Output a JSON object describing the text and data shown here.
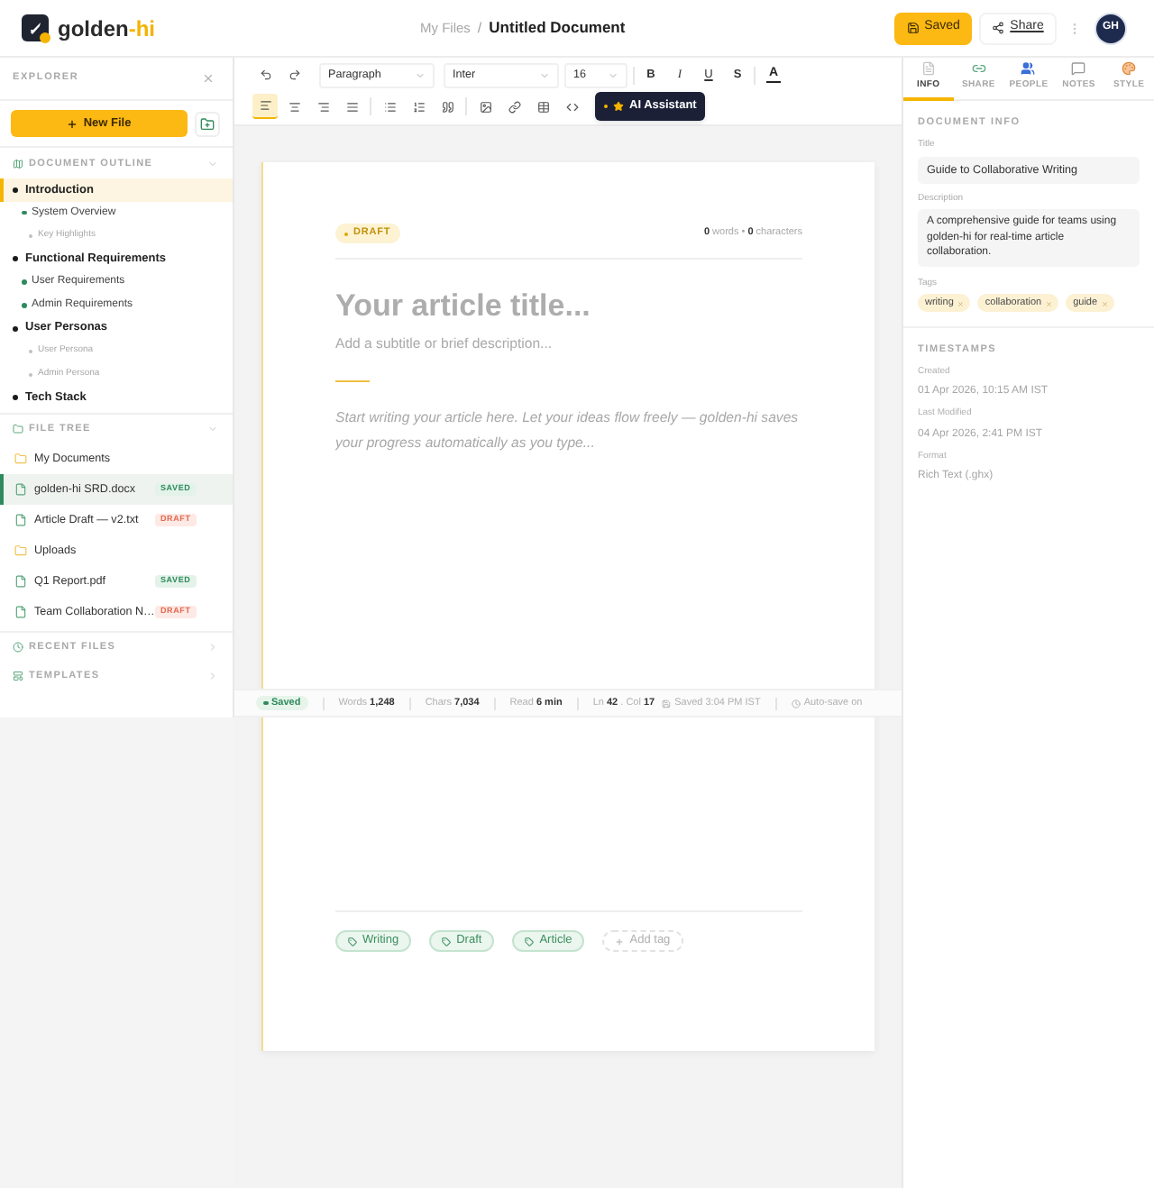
{
  "header": {
    "logo": {
      "name": "golden",
      "accent": "-hi"
    },
    "breadcrumb": {
      "parent": "My Files",
      "separator": "/",
      "current": "Untitled Document"
    },
    "actions": [
      {
        "kind": "save",
        "label": "Saved"
      },
      {
        "kind": "share",
        "label": "Share"
      }
    ],
    "avatar": "GH"
  },
  "sidebar": {
    "title": "EXPLORER",
    "new_file_button": "New File",
    "outline": {
      "title": "DOCUMENT OUTLINE",
      "expanded": true,
      "items": [
        {
          "kind": "h1",
          "label": "Introduction",
          "selected": true,
          "children": [
            {
              "kind": "h2",
              "label": "System Overview",
              "selected": false,
              "children": [
                {
                  "kind": "h3",
                  "label": "Key Highlights",
                  "selected": false
                }
              ]
            }
          ]
        },
        {
          "kind": "h1",
          "label": "Functional Requirements",
          "selected": false,
          "children": [
            {
              "kind": "h2",
              "label": "User Requirements",
              "selected": false
            },
            {
              "kind": "h2",
              "label": "Admin Requirements",
              "selected": false
            }
          ]
        },
        {
          "kind": "h1",
          "label": "User Personas",
          "selected": false,
          "children": [
            {
              "kind": "h3",
              "label": "User Persona",
              "selected": false
            },
            {
              "kind": "h3",
              "label": "Admin Persona",
              "selected": false
            }
          ]
        },
        {
          "kind": "h1",
          "label": "Tech Stack",
          "selected": false
        }
      ]
    },
    "file_tree": {
      "title": "FILE TREE",
      "expanded": true,
      "items": [
        {
          "kind": "folder",
          "name": "My Documents",
          "selected": false
        },
        {
          "kind": "file",
          "name": "golden-hi SRD.docx",
          "badge": {
            "kind": "saved",
            "label": "SAVED"
          },
          "selected": true
        },
        {
          "kind": "file",
          "name": "Article Draft — v2.txt",
          "badge": {
            "kind": "draft",
            "label": "DRAFT"
          },
          "selected": false
        },
        {
          "kind": "folder",
          "name": "Uploads",
          "selected": false
        },
        {
          "kind": "file",
          "name": "Q1 Report.pdf",
          "badge": {
            "kind": "saved",
            "label": "SAVED"
          },
          "selected": false
        },
        {
          "kind": "file",
          "name": "Team Collaboration N…",
          "badge": {
            "kind": "draft",
            "label": "DRAFT"
          },
          "selected": false
        }
      ]
    },
    "collapsed_sections": [
      {
        "kind": "recent",
        "title": "RECENT FILES",
        "expanded": false
      },
      {
        "kind": "templates",
        "title": "TEMPLATES",
        "expanded": false
      }
    ]
  },
  "toolbar": {
    "selects": [
      {
        "kind": "block",
        "value": "Paragraph"
      },
      {
        "kind": "font",
        "value": "Inter"
      },
      {
        "kind": "size",
        "value": "16"
      }
    ],
    "format_buttons": [
      {
        "kind": "bold",
        "label": "B"
      },
      {
        "kind": "italic",
        "label": "I"
      },
      {
        "kind": "underline",
        "label": "U"
      },
      {
        "kind": "strike",
        "label": "S"
      }
    ],
    "text_color": "A",
    "alignment": [
      {
        "kind": "left",
        "selected": true
      },
      {
        "kind": "center",
        "selected": false
      },
      {
        "kind": "right",
        "selected": false
      },
      {
        "kind": "justify",
        "selected": false
      }
    ],
    "ai_button": "AI Assistant"
  },
  "editor": {
    "status": "DRAFT",
    "count": "**0** words • **0** characters",
    "title_field": {
      "placeholder": "Your article title..."
    },
    "subtitle_field": {
      "placeholder": "Add a subtitle or brief description..."
    },
    "body_field": {
      "placeholder": "Start writing your article here. Let your ideas flow freely — golden-hi saves your progress automatically as you type..."
    },
    "tags": [
      "Writing",
      "Draft",
      "Article"
    ],
    "add_tag": "Add tag"
  },
  "status_bar": {
    "state": "Saved",
    "stats": [
      "Words **1,248**",
      "Chars **7,034**",
      "Read **6 min**"
    ],
    "position": "Ln **42** . Col **17**",
    "last_saved": "Saved 3:04 PM IST",
    "autosave": "Auto-save on"
  },
  "panel": {
    "tabs": [
      {
        "kind": "info",
        "label": "INFO",
        "selected": true
      },
      {
        "kind": "share",
        "label": "SHARE",
        "selected": false
      },
      {
        "kind": "people",
        "label": "PEOPLE",
        "selected": false
      },
      {
        "kind": "notes",
        "label": "NOTES",
        "selected": false
      },
      {
        "kind": "style",
        "label": "STYLE",
        "selected": false
      }
    ],
    "document_info": {
      "title": "DOCUMENT INFO",
      "fields": [
        {
          "kind": "line",
          "label": "Title",
          "value": "Guide to Collaborative Writing"
        },
        {
          "kind": "multiline",
          "label": "Description",
          "value": "A comprehensive guide for teams using golden-hi for real-time article collaboration."
        }
      ],
      "tags_label": "Tags",
      "tags": [
        "writing",
        "collaboration",
        "guide"
      ]
    },
    "timestamps": {
      "title": "TIMESTAMPS",
      "items": [
        {
          "label": "Created",
          "value": "01 Apr 2026, 10:15 AM IST"
        },
        {
          "label": "Last Modified",
          "value": "04 Apr 2026, 2:41 PM IST"
        },
        {
          "label": "Format",
          "value": "Rich Text (.ghx)"
        }
      ]
    }
  }
}
